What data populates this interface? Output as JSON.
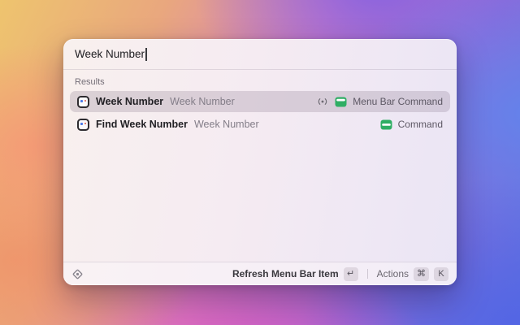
{
  "window": {
    "search": {
      "value": "Week Number",
      "placeholder": ""
    },
    "results_header": "Results",
    "rows": [
      {
        "title": "Week Number",
        "subtitle": "Week Number",
        "type_label": "Menu Bar Command",
        "selected": true,
        "accessories": [
          "broadcast-icon",
          "menu-bar-icon"
        ]
      },
      {
        "title": "Find Week Number",
        "subtitle": "Week Number",
        "type_label": "Command",
        "selected": false,
        "accessories": [
          "command-icon"
        ]
      }
    ],
    "footer": {
      "primary_action": "Refresh Menu Bar Item",
      "primary_key": "↵",
      "actions_label": "Actions",
      "cmd_key": "⌘",
      "k_key": "K"
    }
  },
  "icons": {
    "row_left": "extension-icon",
    "row1_accessory_1": "broadcast-icon",
    "row1_accessory_2": "menu-bar-icon",
    "row2_accessory": "command-icon",
    "footer_left": "diamond-script-icon"
  },
  "colors": {
    "accent_green": "#2fae64",
    "selection_highlight": "rgba(118,100,122,0.22)",
    "window_tint_left": "#f8f0ee",
    "window_tint_right": "#eae5f5",
    "wallpaper_yellow": "#eec46e",
    "wallpaper_salmon": "#f59a76",
    "wallpaper_magenta": "#e250be",
    "wallpaper_purple": "#8f6cd8",
    "wallpaper_blue": "#5f74e2"
  }
}
